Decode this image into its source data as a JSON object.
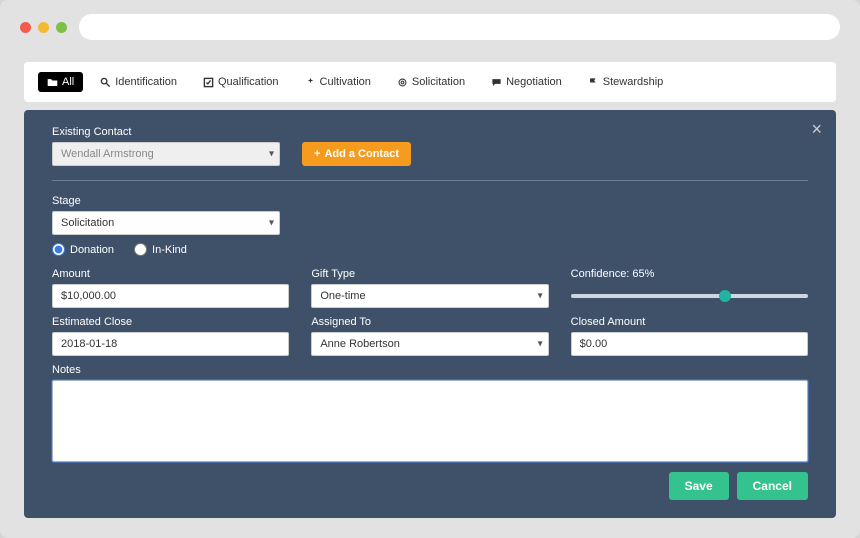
{
  "tabs": {
    "all": "All",
    "identification": "Identification",
    "qualification": "Qualification",
    "cultivation": "Cultivation",
    "solicitation": "Solicitation",
    "negotiation": "Negotiation",
    "stewardship": "Stewardship"
  },
  "form": {
    "existing_contact_label": "Existing Contact",
    "existing_contact_value": "Wendall Armstrong",
    "add_contact_label": "Add a Contact",
    "stage_label": "Stage",
    "stage_value": "Solicitation",
    "radio_donation": "Donation",
    "radio_inkind": "In-Kind",
    "amount_label": "Amount",
    "amount_value": "$10,000.00",
    "gift_type_label": "Gift Type",
    "gift_type_value": "One-time",
    "confidence_label": "Confidence: 65%",
    "confidence_pct": 65,
    "est_close_label": "Estimated Close",
    "est_close_value": "2018-01-18",
    "assigned_to_label": "Assigned To",
    "assigned_to_value": "Anne Robertson",
    "closed_amount_label": "Closed Amount",
    "closed_amount_value": "$0.00",
    "notes_label": "Notes"
  },
  "buttons": {
    "save": "Save",
    "cancel": "Cancel"
  }
}
